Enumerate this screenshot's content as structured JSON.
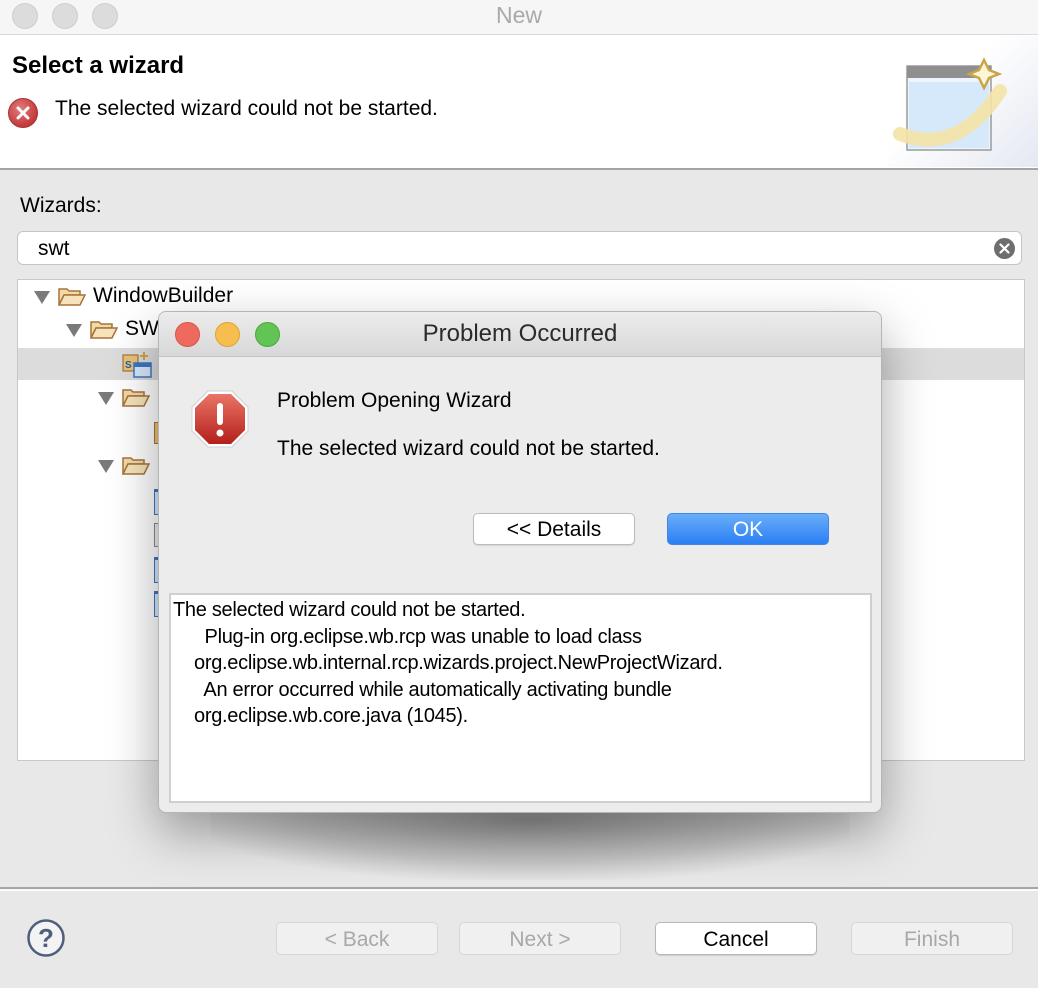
{
  "window": {
    "title": "New"
  },
  "header": {
    "title": "Select a wizard",
    "error_message": "The selected wizard could not be started.",
    "error_icon": "error-circle-x-icon",
    "banner_icon": "new-wizard-banner-icon"
  },
  "wizards": {
    "label": "Wizards:",
    "search_value": "swt",
    "clear_icon": "clear-search-icon",
    "tree": [
      {
        "label": "WindowBuilder",
        "level": 0,
        "expanded": true,
        "type": "folder"
      },
      {
        "label": "SW",
        "level": 1,
        "expanded": true,
        "type": "folder"
      },
      {
        "label": "",
        "level": 2,
        "type": "swt-project-wizard",
        "selected": true
      },
      {
        "label": "",
        "level": 2,
        "expanded": true,
        "type": "folder"
      },
      {
        "label": "",
        "level": 3,
        "type": "item"
      },
      {
        "label": "",
        "level": 2,
        "expanded": true,
        "type": "folder"
      },
      {
        "label": "",
        "level": 3,
        "type": "item"
      },
      {
        "label": "",
        "level": 3,
        "type": "item"
      },
      {
        "label": "",
        "level": 3,
        "type": "item"
      },
      {
        "label": "",
        "level": 3,
        "type": "item"
      }
    ]
  },
  "dialog": {
    "title": "Problem Occurred",
    "heading": "Problem Opening Wizard",
    "message": "The selected wizard could not be started.",
    "details_button": "<< Details",
    "ok_button": "OK",
    "details_text": "The selected wizard could not be started.\n      Plug-in org.eclipse.wb.rcp was unable to load class\n    org.eclipse.wb.internal.rcp.wizards.project.NewProjectWizard.\n      An error occurred while automatically activating bundle\n    org.eclipse.wb.core.java (1045).",
    "accent_color": "#2f82f5"
  },
  "footer": {
    "help_icon": "help-question-icon",
    "back_button": "< Back",
    "next_button": "Next >",
    "cancel_button": "Cancel",
    "finish_button": "Finish"
  }
}
